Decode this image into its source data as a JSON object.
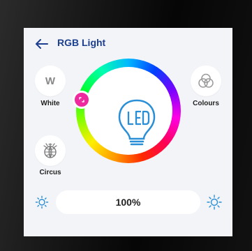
{
  "header": {
    "title": "RGB Light"
  },
  "modes": {
    "white": {
      "label": "White",
      "letter": "W"
    },
    "colours": {
      "label": "Colours"
    },
    "circus": {
      "label": "Circus"
    }
  },
  "brightness": {
    "value": "100%",
    "level": 1.0
  },
  "colors": {
    "accent": "#1d3f8f",
    "icon_blue": "#2a8fd6",
    "selected_hue": "#ef2a9f",
    "screen_bg": "#f3f4f8"
  },
  "icons": [
    "back-arrow-icon",
    "white-mode-icon",
    "colours-icon",
    "circus-icon",
    "led-bulb-icon",
    "brightness-down-icon",
    "brightness-up-icon"
  ]
}
